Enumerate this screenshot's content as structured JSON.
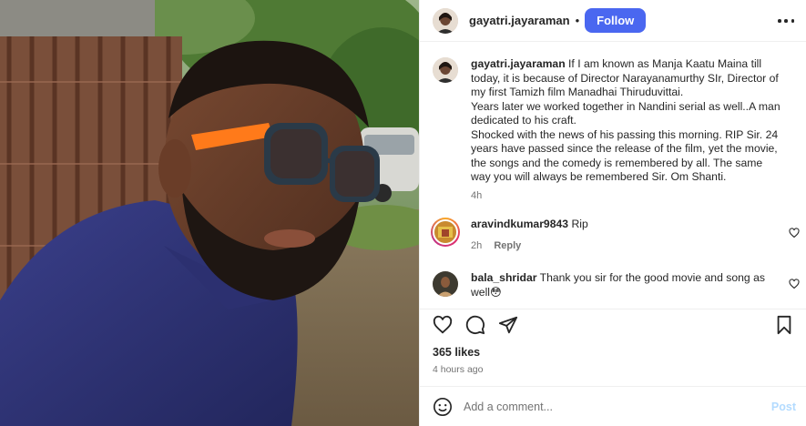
{
  "post": {
    "author": "gayatri.jayaraman",
    "separator": "•",
    "follow_label": "Follow",
    "more_icon": "more-horizontal-icon",
    "caption": {
      "username": "gayatri.jayaraman",
      "line1": "If I am known as Manja Kaatu Maina till today, it is because of Director Narayanamurthy SIr, Director of my first Tamizh film Manadhai Thiruduvittai.",
      "line2": "Years later we worked together in Nandini serial as well..A man dedicated to his craft.",
      "line3": "Shocked with the news of his passing this morning. RIP Sir. 24 years have passed since the release of the film, yet the movie, the songs and the comedy is remembered by all. The same way you will always be remembered Sir. Om Shanti.",
      "time": "4h"
    },
    "comments": [
      {
        "username": "aravindkumar9843",
        "text": "Rip",
        "time": "2h",
        "reply_label": "Reply"
      },
      {
        "username": "bala_shridar",
        "text": "Thank you sir for the good movie and song as well😳",
        "time": "",
        "reply_label": ""
      }
    ],
    "likes": "365 likes",
    "time_ago": "4 hours ago",
    "add_comment_placeholder": "Add a comment...",
    "post_label": "Post",
    "colors": {
      "follow_button": "#4a67f0",
      "post_disabled": "#b3dbff",
      "muted_text": "#737373"
    },
    "icons": [
      "heart-icon",
      "comment-icon",
      "share-icon",
      "bookmark-icon",
      "emoji-icon"
    ]
  }
}
